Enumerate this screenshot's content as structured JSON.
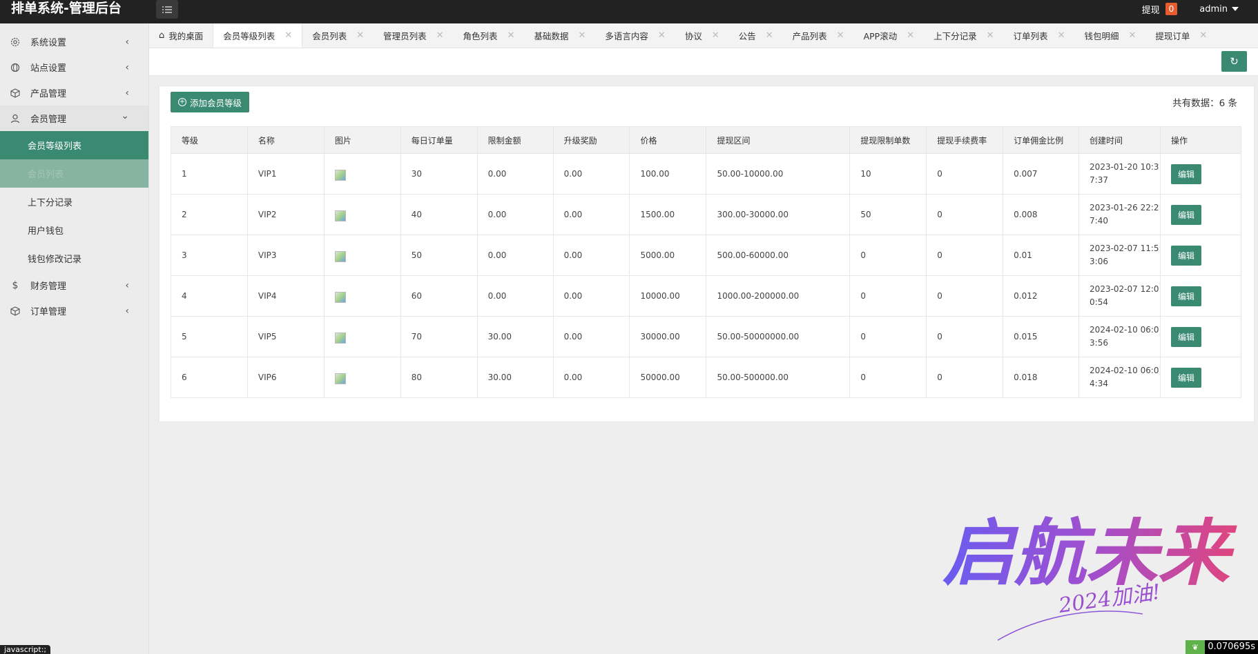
{
  "app": {
    "title": "排单系统-管理后台"
  },
  "header": {
    "withdraw_label": "提现",
    "withdraw_count": "0",
    "user": "admin"
  },
  "sidebar": {
    "items": [
      {
        "label": "系统设置",
        "icon": "gear-icon"
      },
      {
        "label": "站点设置",
        "icon": "globe-icon"
      },
      {
        "label": "产品管理",
        "icon": "box-icon"
      },
      {
        "label": "会员管理",
        "icon": "user-icon"
      }
    ],
    "sub_items": [
      {
        "label": "会员等级列表"
      },
      {
        "label": "会员列表"
      },
      {
        "label": "上下分记录"
      },
      {
        "label": "用户钱包"
      },
      {
        "label": "钱包修改记录"
      }
    ],
    "bottom_items": [
      {
        "label": "财务管理",
        "icon": "dollar-icon"
      },
      {
        "label": "订单管理",
        "icon": "box-icon"
      }
    ]
  },
  "tabs": [
    {
      "label": "我的桌面"
    },
    {
      "label": "会员等级列表"
    },
    {
      "label": "会员列表"
    },
    {
      "label": "管理员列表"
    },
    {
      "label": "角色列表"
    },
    {
      "label": "基础数据"
    },
    {
      "label": "多语言内容"
    },
    {
      "label": "协议"
    },
    {
      "label": "公告"
    },
    {
      "label": "产品列表"
    },
    {
      "label": "APP滚动"
    },
    {
      "label": "上下分记录"
    },
    {
      "label": "订单列表"
    },
    {
      "label": "钱包明细"
    },
    {
      "label": "提现订单"
    }
  ],
  "toolbar": {
    "add_label": "添加会员等级",
    "total_text": "共有数据：6 条"
  },
  "table": {
    "headers": [
      "等级",
      "名称",
      "图片",
      "每日订单量",
      "限制金额",
      "升级奖励",
      "价格",
      "提现区间",
      "提现限制单数",
      "提现手续费率",
      "订单佣金比例",
      "创建时间",
      "操作"
    ],
    "rows": [
      [
        "1",
        "VIP1",
        "30",
        "0.00",
        "0.00",
        "100.00",
        "50.00-10000.00",
        "10",
        "0",
        "0.007",
        "2023-01-20 10:3",
        "7:37"
      ],
      [
        "2",
        "VIP2",
        "40",
        "0.00",
        "0.00",
        "1500.00",
        "300.00-30000.00",
        "50",
        "0",
        "0.008",
        "2023-01-26 22:2",
        "7:40"
      ],
      [
        "3",
        "VIP3",
        "50",
        "0.00",
        "0.00",
        "5000.00",
        "500.00-60000.00",
        "0",
        "0",
        "0.01",
        "2023-02-07 11:5",
        "3:06"
      ],
      [
        "4",
        "VIP4",
        "60",
        "0.00",
        "0.00",
        "10000.00",
        "1000.00-200000.00",
        "0",
        "0",
        "0.012",
        "2023-02-07 12:0",
        "0:54"
      ],
      [
        "5",
        "VIP5",
        "70",
        "30.00",
        "0.00",
        "30000.00",
        "50.00-50000000.00",
        "0",
        "0",
        "0.015",
        "2024-02-10 06:0",
        "3:56"
      ],
      [
        "6",
        "VIP6",
        "80",
        "30.00",
        "0.00",
        "50000.00",
        "50.00-500000.00",
        "0",
        "0",
        "0.018",
        "2024-02-10 06:0",
        "4:34"
      ]
    ],
    "edit_label": "编辑"
  },
  "watermark": {
    "main": "启航未来",
    "sub": "2024加油!"
  },
  "status": {
    "js": "javascript:;",
    "timing": "0.070695s"
  },
  "colors": {
    "accent": "#3a8a72",
    "topbar": "#222222",
    "badge": "#e65c2e"
  }
}
